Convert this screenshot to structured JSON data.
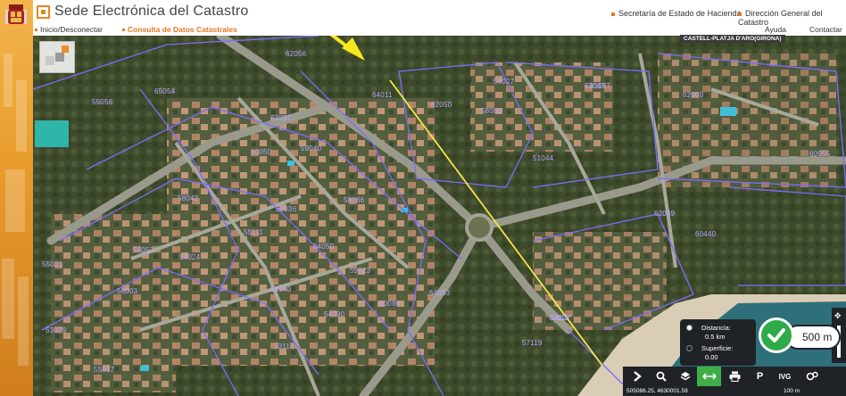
{
  "header": {
    "title": "Sede Electrónica del Catastro",
    "links": [
      "Secretaría de Estado de Hacienda",
      "Dirección General del Catastro"
    ]
  },
  "nav": {
    "login": "Inicio/Desconectar",
    "consulta": "Consulta de Datos Catastrales",
    "ayuda": "Ayuda",
    "contactar": "Contactar"
  },
  "map": {
    "municipality": "CASTELL-PLATJA D'ARO(GIRONA)",
    "parcels": [
      "62056",
      "65054",
      "63097",
      "64011",
      "54027",
      "55056",
      "60050",
      "59040",
      "62050",
      "58060",
      "63067",
      "58042",
      "60036",
      "58086",
      "55111",
      "64050",
      "54940",
      "51044",
      "59023",
      "61067",
      "62000",
      "62039",
      "60119",
      "60440",
      "60955",
      "55021",
      "54024",
      "56053",
      "56003",
      "60086",
      "53029",
      "54090",
      "54053",
      "55017",
      "53114",
      "57119",
      "54127"
    ],
    "colors": {
      "parcel_outline": "#7d6cff",
      "measure_line": "#f2e547",
      "arrow": "#f5e81f",
      "accent": "#e87722",
      "active_tool": "#3fae49"
    }
  },
  "measure": {
    "distance_label": "Distancia:",
    "distance_value": "0.5 km",
    "area_label": "Superficie:",
    "area_value": "0.00",
    "scale_badge": "500 m"
  },
  "toolbar": {
    "tools": [
      "chevron-right-icon",
      "search-icon",
      "layers-icon",
      "measure-icon",
      "print-icon",
      "parking-icon",
      "ivg-icon",
      "settings-icon"
    ],
    "ivg_label": "IVG",
    "parking_label": "P"
  },
  "status": {
    "coordinates": "505086.25, 4630001.59",
    "scale": "100 m"
  }
}
